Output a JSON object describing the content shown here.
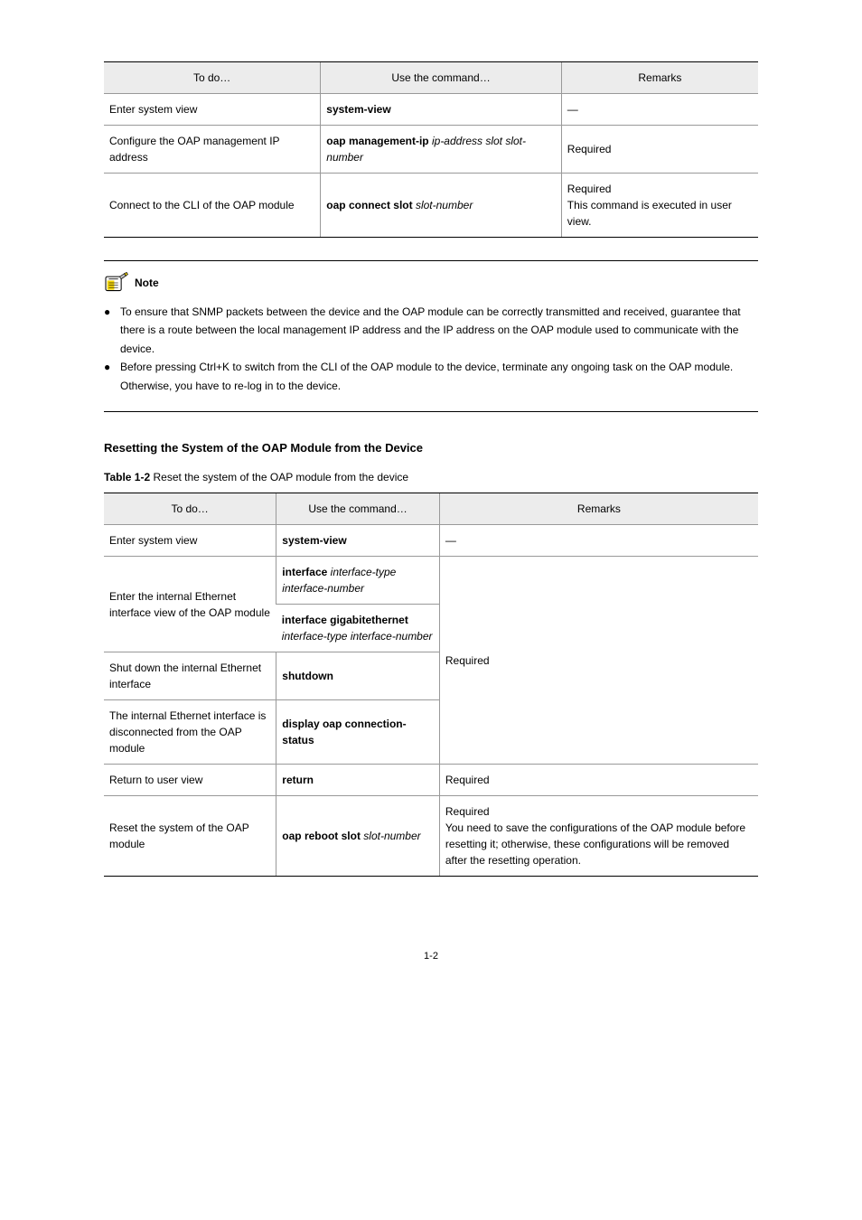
{
  "table1": {
    "headers": [
      "To do…",
      "Use the command…",
      "Remarks"
    ],
    "rows": [
      {
        "c1": "Enter system view",
        "c2_cmd": "system-view",
        "c2_rest": "",
        "c3": "—"
      },
      {
        "c1": "Configure the OAP management IP address",
        "c2_cmd": "oap management-ip",
        "c2_rest": " ip-address slot slot-number",
        "c3": "Required"
      },
      {
        "c1": "Connect to the CLI of the OAP module",
        "c2_cmd": "oap connect slot",
        "c2_rest": " slot-number",
        "c3": "Required\nThis command is executed in user view."
      }
    ]
  },
  "note": {
    "label": "Note",
    "bullets": [
      "To ensure that SNMP packets between the device and the OAP module can be correctly transmitted and received, guarantee that there is a route between the local management IP address and the IP address on the OAP module used to communicate with the device.",
      "Before pressing Ctrl+K to switch from the CLI of the OAP module to the device, terminate any ongoing task on the OAP module. Otherwise, you have to re-log in to the device."
    ]
  },
  "section": {
    "title": "Resetting the System of the OAP Module from the Device",
    "caption_strong": "Table 1-2",
    "caption_rest": " Reset the system of the OAP module from the device"
  },
  "table2": {
    "headers": [
      "To do…",
      "Use the command…",
      "Remarks"
    ],
    "rows": [
      {
        "c1": "Enter system view",
        "c2_cmd": "system-view",
        "c2_rest": "",
        "c3": "—",
        "rowspan": 1
      },
      {
        "c1": "Enter the internal Ethernet interface view of the OAP module",
        "c2a_cmd": "interface",
        "c2a_rest": " interface-type interface-number",
        "c2b_cmd": "interface gigabitethernet",
        "c2b_rest": " interface-type interface-number",
        "c3": "",
        "two_cmd": true
      },
      {
        "c1": "Shut down the internal Ethernet interface",
        "c2_cmd": "shutdown",
        "c2_rest": "",
        "c3": "Required",
        "c3_rowspan": 3,
        "c3_start": true
      },
      {
        "c1": "The internal Ethernet interface is disconnected from the OAP module",
        "c2_cmd": "display oap connection-status",
        "c2_rest": "",
        "c3": "",
        "c3_skip": true
      },
      {
        "c1": "Return to user view",
        "c2_cmd": "return",
        "c2_rest": "",
        "c3": "Required"
      },
      {
        "c1": "Reset the system of the OAP module",
        "c2_cmd": "oap reboot slot",
        "c2_rest": " slot-number",
        "c3": "Required\nYou need to save the configurations of the OAP module before resetting it; otherwise, these configurations will be removed after the resetting operation."
      }
    ]
  },
  "page_num": "1-2"
}
